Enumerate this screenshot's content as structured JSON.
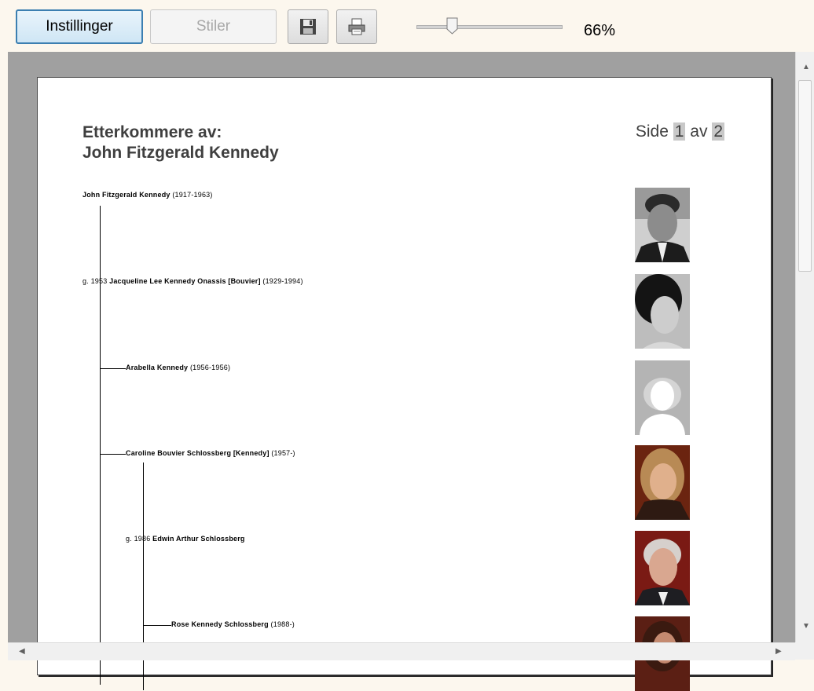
{
  "toolbar": {
    "settings_label": "Instillinger",
    "styles_label": "Stiler",
    "save_icon": "save-icon",
    "print_icon": "print-icon",
    "zoom": {
      "value": 66,
      "label": "66%"
    }
  },
  "report": {
    "title_line1": "Etterkommere av:",
    "title_line2": "John Fitzgerald Kennedy",
    "page": {
      "label_side": "Side",
      "current": "1",
      "label_av": "av",
      "total": "2"
    },
    "entries": [
      {
        "prefix": "",
        "name": "John Fitzgerald Kennedy",
        "dates": "(1917-1963)"
      },
      {
        "prefix": "g. 1953",
        "name": "Jacqueline Lee Kennedy Onassis [Bouvier]",
        "dates": "(1929-1994)"
      },
      {
        "prefix": "",
        "name": "Arabella Kennedy",
        "dates": "(1956-1956)"
      },
      {
        "prefix": "",
        "name": "Caroline Bouvier Schlossberg [Kennedy]",
        "dates": "(1957-)"
      },
      {
        "prefix": "g. 1986",
        "name": "Edwin Arthur Schlossberg",
        "dates": ""
      },
      {
        "prefix": "",
        "name": "Rose Kennedy  Schlossberg",
        "dates": "(1988-)"
      }
    ]
  }
}
